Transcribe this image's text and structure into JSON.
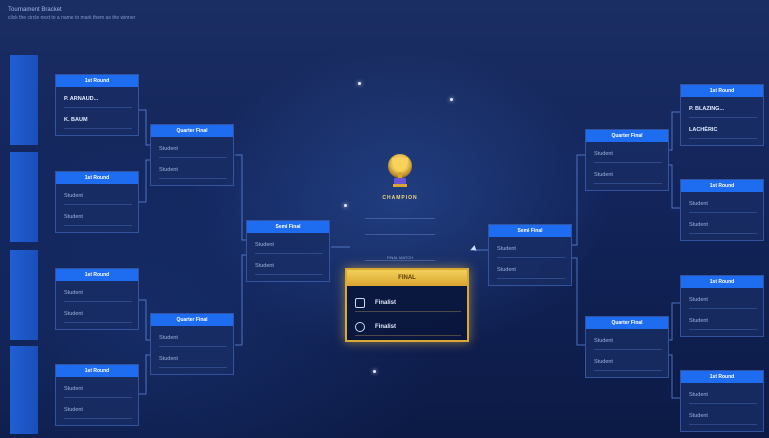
{
  "instructions": {
    "line1": "Tournament Bracket",
    "line2": "click the circle next to a name to mark them as the winner"
  },
  "colors": {
    "accent": "#1e6df0",
    "final_border": "#d8a935",
    "background": "#12245a"
  },
  "left_bracket": [
    {
      "header": "1st Round",
      "slots": [
        "P. ARNAUD...",
        "K. BAUM"
      ],
      "named": true
    },
    {
      "header": "1st Round",
      "slots": [
        "Student",
        "Student"
      ],
      "named": false
    },
    {
      "header": "1st Round",
      "slots": [
        "Student",
        "Student"
      ],
      "named": false
    },
    {
      "header": "1st Round",
      "slots": [
        "Student",
        "Student"
      ],
      "named": false
    },
    {
      "header": "Quarter Final",
      "slots": [
        "Student",
        "Student"
      ],
      "named": false
    },
    {
      "header": "Quarter Final",
      "slots": [
        "Student",
        "Student"
      ],
      "named": false
    },
    {
      "header": "Semi Final",
      "slots": [
        "Student",
        "Student"
      ],
      "named": false
    }
  ],
  "right_bracket": [
    {
      "header": "1st Round",
      "slots": [
        "P. BLAZING...",
        "LACHÈRIC"
      ],
      "named": true
    },
    {
      "header": "1st Round",
      "slots": [
        "Student",
        "Student"
      ],
      "named": false
    },
    {
      "header": "1st Round",
      "slots": [
        "Student",
        "Student"
      ],
      "named": false
    },
    {
      "header": "1st Round",
      "slots": [
        "Student",
        "Student"
      ],
      "named": false
    },
    {
      "header": "Quarter Final",
      "slots": [
        "Student",
        "Student"
      ],
      "named": false
    },
    {
      "header": "Quarter Final",
      "slots": [
        "Student",
        "Student"
      ],
      "named": false
    },
    {
      "header": "Semi Final",
      "slots": [
        "Student",
        "Student"
      ],
      "named": false
    }
  ],
  "champion": {
    "title": "CHAMPION",
    "lines": [
      "",
      "",
      "FINAL MATCH"
    ]
  },
  "final": {
    "header": "FINAL",
    "slots": [
      "Finalist",
      "Finalist"
    ]
  },
  "icons": {
    "trophy": "trophy-icon",
    "checkbox": "checkbox-icon",
    "radio": "radio-icon",
    "cursor": "mouse-cursor-icon"
  }
}
